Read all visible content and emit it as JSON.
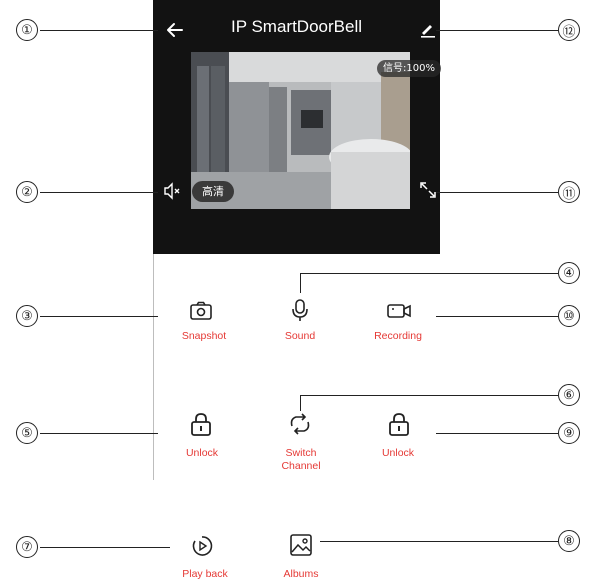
{
  "header": {
    "title": "IP SmartDoorBell"
  },
  "video": {
    "signal": "信号:100%",
    "quality": "高清"
  },
  "controls": {
    "snapshot": "Snapshot",
    "sound": "Sound",
    "recording": "Recording",
    "unlock_left": "Unlock",
    "switch_channel": "Switch\nChannel",
    "unlock_right": "Unlock",
    "play_back": "Play back",
    "albums": "Albums"
  },
  "callouts": {
    "c1": "①",
    "c2": "②",
    "c3": "③",
    "c4": "④",
    "c5": "⑤",
    "c6": "⑥",
    "c7": "⑦",
    "c8": "⑧",
    "c9": "⑨",
    "c10": "⑩",
    "c11": "⑪",
    "c12": "⑫"
  },
  "colors": {
    "label_red": "#e53935",
    "header_dark": "#121212"
  }
}
